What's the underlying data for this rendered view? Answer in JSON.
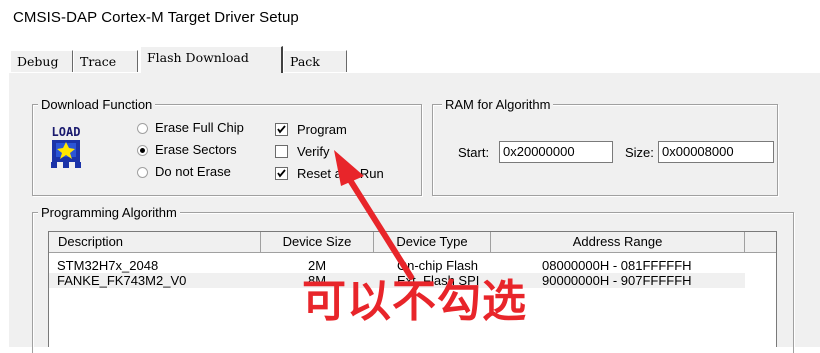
{
  "window": {
    "title": "CMSIS-DAP Cortex-M Target Driver Setup"
  },
  "tabs": [
    {
      "label": "Debug",
      "active": false
    },
    {
      "label": "Trace",
      "active": false
    },
    {
      "label": "Flash Download",
      "active": true
    },
    {
      "label": "Pack",
      "active": false
    }
  ],
  "download_function": {
    "group_label": "Download Function",
    "icon_text": "LOAD",
    "radios": [
      {
        "label": "Erase Full Chip",
        "selected": false
      },
      {
        "label": "Erase Sectors",
        "selected": true
      },
      {
        "label": "Do not Erase",
        "selected": false
      }
    ],
    "checkboxes": [
      {
        "label": "Program",
        "checked": true
      },
      {
        "label": "Verify",
        "checked": false
      },
      {
        "label": "Reset and Run",
        "checked": true
      }
    ]
  },
  "ram_for_algorithm": {
    "group_label": "RAM for Algorithm",
    "start_label": "Start:",
    "start_value": "0x20000000",
    "size_label": "Size:",
    "size_value": "0x00008000"
  },
  "programming_algorithm": {
    "group_label": "Programming Algorithm",
    "columns": [
      "Description",
      "Device Size",
      "Device Type",
      "Address Range"
    ],
    "rows": [
      {
        "description": "STM32H7x_2048",
        "size": "2M",
        "type": "On-chip Flash",
        "range": "08000000H - 081FFFFFH"
      },
      {
        "description": "FANKE_FK743M2_V0",
        "size": "8M",
        "type": "Ext. Flash SPI",
        "range": "90000000H - 907FFFFFH"
      }
    ]
  },
  "annotation": {
    "text": "可以不勾选",
    "color": "#e8252a"
  }
}
